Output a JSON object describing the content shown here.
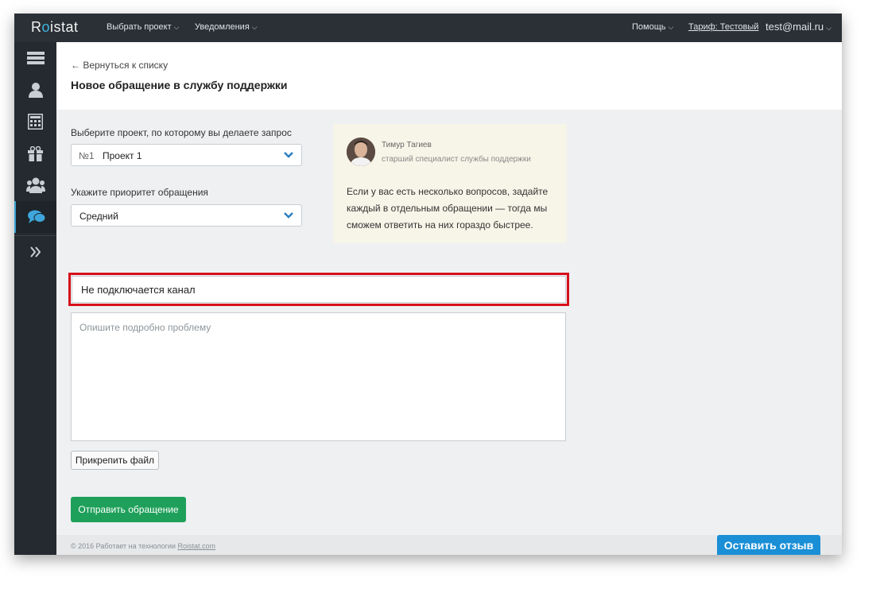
{
  "app": {
    "logo_text_1": "R",
    "logo_text_o": "o",
    "logo_text_2": "istat",
    "accent": "#3fb6e0"
  },
  "topnav": {
    "choose_project": "Выбрать проект",
    "notifications": "Уведомления",
    "help": "Помощь",
    "tariff": "Тариф: Тестовый",
    "user": "test@mail.ru"
  },
  "sidebar": {
    "items": [
      {
        "icon": "servers-icon"
      },
      {
        "icon": "user-icon"
      },
      {
        "icon": "calculator-icon"
      },
      {
        "icon": "gift-icon"
      },
      {
        "icon": "users-icon"
      },
      {
        "icon": "chat-icon",
        "active": true
      },
      {
        "icon": "double-chevron-right-icon"
      }
    ]
  },
  "header": {
    "back_link": "← Вернуться к списку",
    "title": "Новое обращение в службу поддержки"
  },
  "form": {
    "project_label": "Выберите проект, по которому вы делаете запрос",
    "project_number": "№1",
    "project_value": "Проект 1",
    "priority_label": "Укажите приоритет обращения",
    "priority_value": "Средний",
    "subject_value": "Не подключается канал",
    "description_placeholder": "Опишите подробно проблему",
    "attach_label": "Прикрепить файл",
    "submit_label": "Отправить обращение"
  },
  "tip": {
    "name": "Тимур Тагиев",
    "role": "старший специалист службы поддержки",
    "line1": "Если у вас есть несколько вопросов, задайте",
    "line2": "каждый в отдельным обращении — тогда мы",
    "line3": "сможем ответить на них гораздо быстрее."
  },
  "footer": {
    "text": "© 2016 Работает на технологии",
    "link": "Roistat.com"
  },
  "feedback_label": "Оставить отзыв"
}
